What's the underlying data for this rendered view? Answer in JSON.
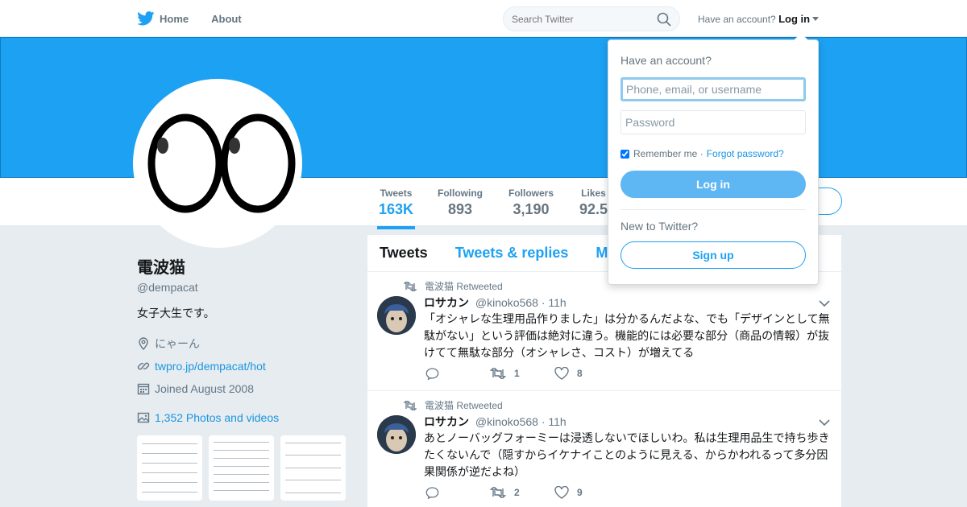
{
  "colors": {
    "brand": "#1da1f2",
    "link": "#1b95e0",
    "muted": "#657786"
  },
  "nav": {
    "home_label": "Home",
    "about_label": "About",
    "search_placeholder": "Search Twitter",
    "have_account": "Have an account?",
    "login_label": "Log in"
  },
  "stats": [
    {
      "label": "Tweets",
      "value": "163K"
    },
    {
      "label": "Following",
      "value": "893"
    },
    {
      "label": "Followers",
      "value": "3,190"
    },
    {
      "label": "Likes",
      "value": "92.5"
    }
  ],
  "profile": {
    "name": "電波猫",
    "handle": "@dempacat",
    "bio": "女子大生です。",
    "location": "にゃーん",
    "url": "twpro.jp/dempacat/hot",
    "joined": "Joined August 2008",
    "photos": "1,352 Photos and videos"
  },
  "tabs": [
    "Tweets",
    "Tweets & replies",
    "M"
  ],
  "tweets": [
    {
      "retweeted_by": "電波猫 Retweeted",
      "author": "ロサカン",
      "handle": "@kinoko568",
      "time": "· 11h",
      "text": "「オシャレな生理用品作りました」は分かるんだよな、でも「デザインとして無駄がない」という評価は絶対に違う。機能的には必要な部分（商品の情報）が抜けてて無駄な部分（オシャレさ、コスト）が増えてる",
      "retweets": "1",
      "likes": "8"
    },
    {
      "retweeted_by": "電波猫 Retweeted",
      "author": "ロサカン",
      "handle": "@kinoko568",
      "time": "· 11h",
      "text": "あとノーバッグフォーミーは浸透しないでほしいわ。私は生理用品生で持ち歩きたくないんで（隠すからイケナイことのように見える、からかわれるって多分因果関係が逆だよね）",
      "retweets": "2",
      "likes": "9"
    }
  ],
  "login_dropdown": {
    "title": "Have an account?",
    "username_placeholder": "Phone, email, or username",
    "password_placeholder": "Password",
    "remember_label": "Remember me ·",
    "remember_checked": true,
    "forgot_label": "Forgot password?",
    "login_button": "Log in",
    "new_label": "New to Twitter?",
    "signup_button": "Sign up"
  }
}
